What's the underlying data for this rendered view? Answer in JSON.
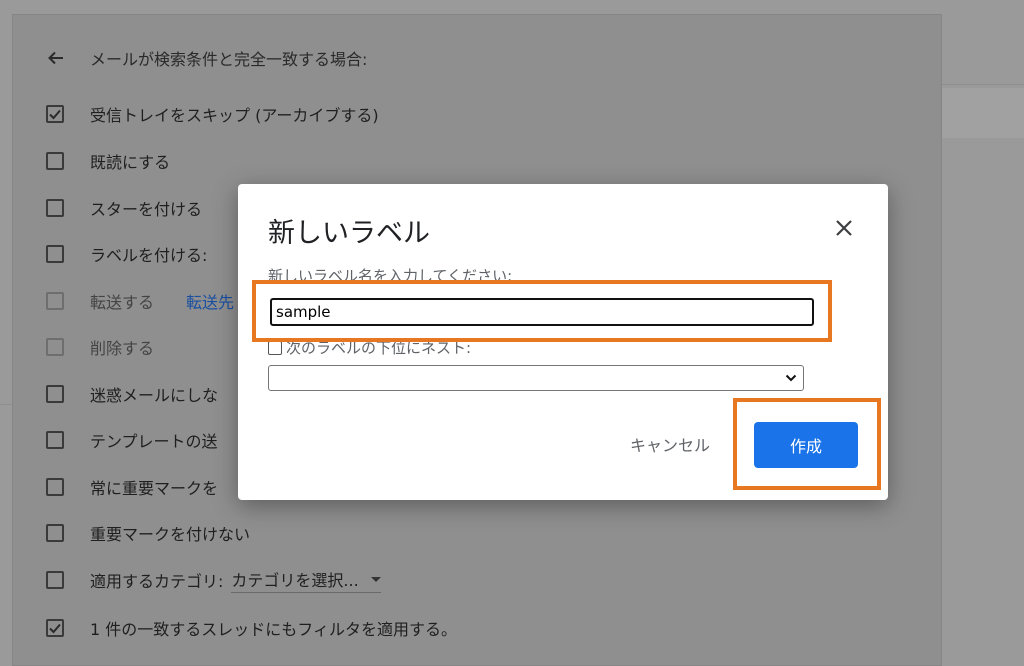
{
  "filter_panel": {
    "header": "メールが検索条件と完全一致する場合:",
    "options": [
      {
        "label": "受信トレイをスキップ (アーカイブする)",
        "checked": true
      },
      {
        "label": "既読にする",
        "checked": false
      },
      {
        "label": "スターを付ける",
        "checked": false
      },
      {
        "label": "ラベルを付ける:",
        "checked": false
      },
      {
        "label": "転送する",
        "checked": false,
        "disabled": true,
        "link": "転送先"
      },
      {
        "label": "削除する",
        "checked": false,
        "disabled": true
      },
      {
        "label": "迷惑メールにしな",
        "checked": false
      },
      {
        "label": "テンプレートの送",
        "checked": false
      },
      {
        "label": "常に重要マークを",
        "checked": false
      },
      {
        "label": "重要マークを付けない",
        "checked": false
      },
      {
        "label": "適用するカテゴリ:",
        "checked": false,
        "select": "カテゴリを選択..."
      },
      {
        "label": "1 件の一致するスレッドにもフィルタを適用する。",
        "checked": true
      }
    ]
  },
  "dialog": {
    "title": "新しいラベル",
    "input_label": "新しいラベル名を入力してください:",
    "input_value": "sample",
    "nest_label": "次のラベルの下位にネスト:",
    "parent_value": "",
    "cancel_label": "キャンセル",
    "create_label": "作成"
  },
  "colors": {
    "primary_button": "#1a73e8",
    "highlight": "#e87722",
    "link": "#1a4fa0"
  },
  "icons": {
    "back": "arrow-left-icon",
    "close": "close-icon",
    "checkbox_checked": "check-icon",
    "dropdown": "chevron-down-icon"
  }
}
